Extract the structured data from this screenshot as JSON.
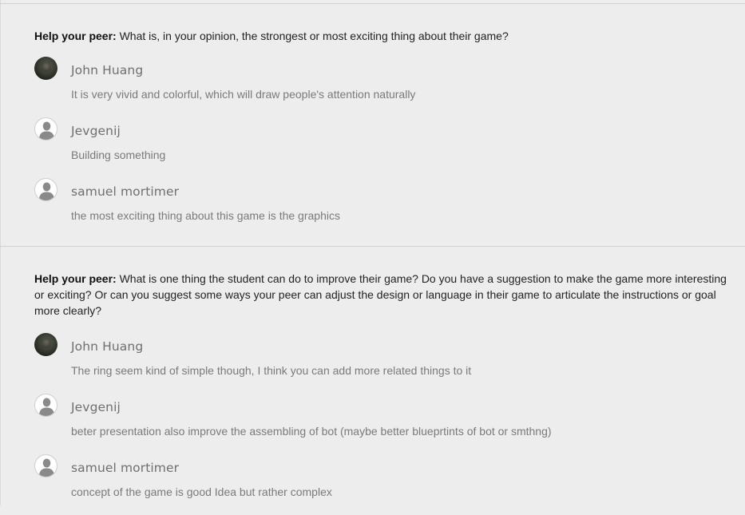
{
  "sections": [
    {
      "label": "Help your peer:",
      "question": "What is, in your opinion, the strongest or most exciting thing about their game?",
      "responses": [
        {
          "name": "John Huang",
          "avatar": "photo",
          "text": "It is very vivid and colorful, which will draw people's attention naturally"
        },
        {
          "name": "Jevgenij",
          "avatar": "default-user-icon",
          "text": "Building something"
        },
        {
          "name": "samuel mortimer",
          "avatar": "default-user-icon",
          "text": "the most exciting thing about this game is the graphics"
        }
      ]
    },
    {
      "label": "Help your peer:",
      "question": "What is one thing the student can do to improve their game? Do you have a suggestion to make the game more interesting or exciting? Or can you suggest some ways your peer can adjust the design or language in their game to articulate the instructions or goal more clearly?",
      "responses": [
        {
          "name": "John Huang",
          "avatar": "photo",
          "text": "The ring seem kind of simple though, I think you can add more related things to it"
        },
        {
          "name": "Jevgenij",
          "avatar": "default-user-icon",
          "text": "beter presentation also improve the assembling of bot (maybe better blueprtints of bot or smthng)"
        },
        {
          "name": "samuel mortimer",
          "avatar": "default-user-icon",
          "text": "concept of the game is good Idea but rather complex"
        }
      ]
    }
  ]
}
